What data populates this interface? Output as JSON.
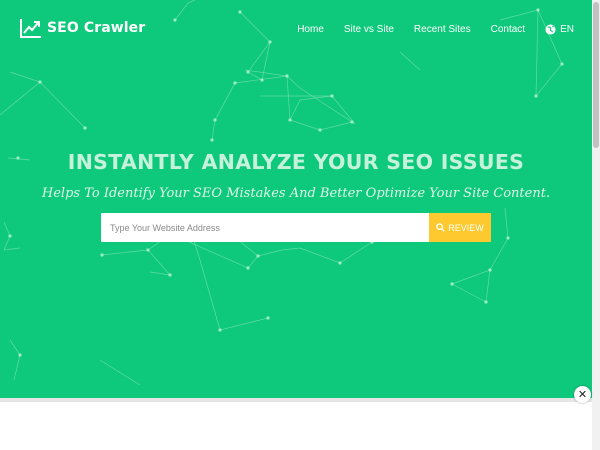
{
  "colors": {
    "hero_background": "#0ec97b",
    "accent_button": "#fdc92e",
    "headline_text": "#c6f2dc",
    "network_lines": "#8fe6b8"
  },
  "brand": {
    "name": "SEO Crawler",
    "icon": "trending-up-chart-icon"
  },
  "nav": {
    "items": [
      {
        "label": "Home"
      },
      {
        "label": "Site vs Site"
      },
      {
        "label": "Recent Sites"
      },
      {
        "label": "Contact"
      }
    ],
    "language": {
      "label": "EN",
      "icon": "globe-icon"
    }
  },
  "hero": {
    "title": "INSTANTLY ANALYZE YOUR SEO ISSUES",
    "subtitle": "Helps To Identify Your SEO Mistakes And Better Optimize Your Site Content."
  },
  "search": {
    "placeholder": "Type Your Website Address",
    "value": "",
    "button_label": "REVIEW",
    "button_icon": "search-icon"
  },
  "overlay": {
    "close_symbol": "✕"
  }
}
